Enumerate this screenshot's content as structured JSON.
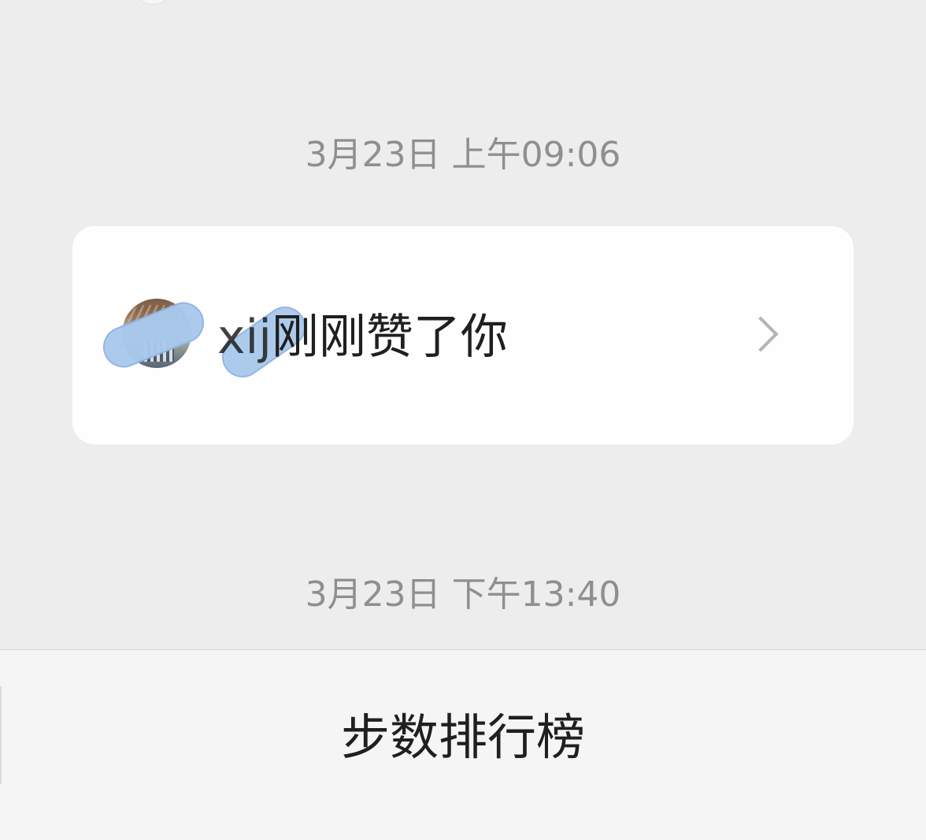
{
  "messages": [
    {
      "timestamp": "3月23日 上午09:06",
      "card": {
        "name_prefix": "xi",
        "name_suffix": "j",
        "message": "刚刚赞了你"
      }
    },
    {
      "timestamp": "3月23日 下午13:40"
    }
  ],
  "bottom_bar": {
    "label": "步数排行榜"
  },
  "icons": {
    "chevron": "chevron-right-icon"
  }
}
